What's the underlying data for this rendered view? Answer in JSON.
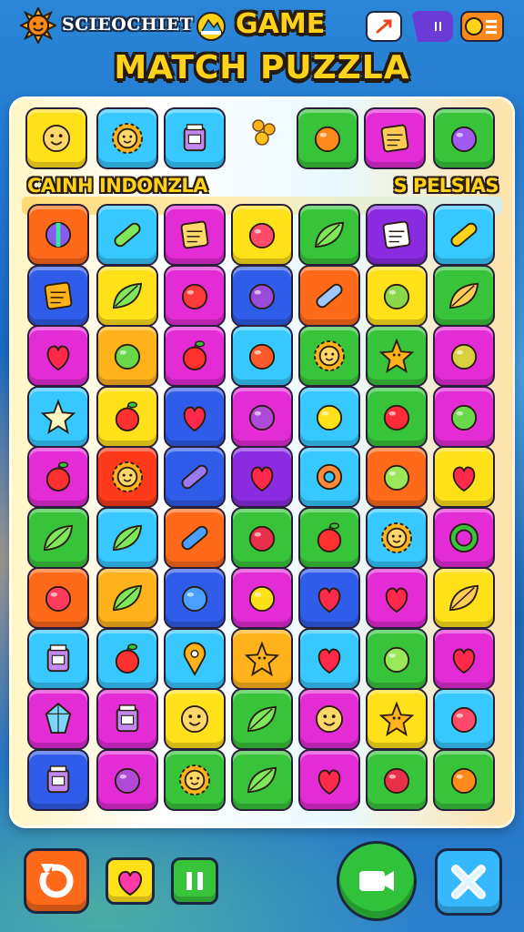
{
  "header": {
    "brand": "SCIEOCHIET",
    "game_word": "GAME",
    "title": "MATCH PUZZLA"
  },
  "board": {
    "label_left": "CAINH INDONZLA",
    "label_right": "S PELSIAS",
    "top_row": [
      {
        "color": "#ffe11a",
        "icon": "happy-face-icon"
      },
      {
        "color": "#36c8ff",
        "icon": "sun-face-icon"
      },
      {
        "color": "#36c8ff",
        "icon": "jar-icon"
      },
      {
        "color": "#37c43a",
        "icon": "orange-fruit-icon"
      },
      {
        "color": "#e32bd6",
        "icon": "toast-icon"
      },
      {
        "color": "#37c43a",
        "icon": "purple-face-icon"
      }
    ],
    "grid": [
      [
        {
          "color": "#ff6a1a",
          "icon": "shield-icon"
        },
        {
          "color": "#36c8ff",
          "icon": "cucumber-icon"
        },
        {
          "color": "#e32bd6",
          "icon": "map-icon"
        },
        {
          "color": "#ffe11a",
          "icon": "lollipop-icon"
        },
        {
          "color": "#37c43a",
          "icon": "leaf-star-icon"
        },
        {
          "color": "#8a2be2",
          "icon": "note-icon"
        },
        {
          "color": "#36c8ff",
          "icon": "banana-icon"
        }
      ],
      [
        {
          "color": "#2f5ce8",
          "icon": "cheese-icon"
        },
        {
          "color": "#ffe11a",
          "icon": "leaf-icon"
        },
        {
          "color": "#e32bd6",
          "icon": "tomato-face-icon"
        },
        {
          "color": "#2f5ce8",
          "icon": "grape-icon"
        },
        {
          "color": "#ff6a1a",
          "icon": "gadget-icon"
        },
        {
          "color": "#ffe11a",
          "icon": "kiwi-icon"
        },
        {
          "color": "#37c43a",
          "icon": "croissant-icon"
        }
      ],
      [
        {
          "color": "#e32bd6",
          "icon": "heart-icon"
        },
        {
          "color": "#ffb21a",
          "icon": "turtle-icon"
        },
        {
          "color": "#e32bd6",
          "icon": "apple-icon"
        },
        {
          "color": "#36c8ff",
          "icon": "pepper-icon"
        },
        {
          "color": "#37c43a",
          "icon": "sunflower-icon"
        },
        {
          "color": "#37c43a",
          "icon": "star-flower-icon"
        },
        {
          "color": "#e32bd6",
          "icon": "melon-icon"
        }
      ],
      [
        {
          "color": "#36c8ff",
          "icon": "star-icon"
        },
        {
          "color": "#ffe11a",
          "icon": "apple-icon"
        },
        {
          "color": "#2f5ce8",
          "icon": "heart-icon"
        },
        {
          "color": "#e32bd6",
          "icon": "ball-icon"
        },
        {
          "color": "#36c8ff",
          "icon": "lemon-icon"
        },
        {
          "color": "#37c43a",
          "icon": "cherry-icon"
        },
        {
          "color": "#e32bd6",
          "icon": "lime-icon"
        }
      ],
      [
        {
          "color": "#e32bd6",
          "icon": "apple-icon"
        },
        {
          "color": "#ff3a1a",
          "icon": "sun-face-icon"
        },
        {
          "color": "#2f5ce8",
          "icon": "eggplant-icon"
        },
        {
          "color": "#8a2be2",
          "icon": "heart-icon"
        },
        {
          "color": "#36c8ff",
          "icon": "donut-icon"
        },
        {
          "color": "#ff6a1a",
          "icon": "leaf-gem-icon"
        },
        {
          "color": "#ffe11a",
          "icon": "heart-icon"
        }
      ],
      [
        {
          "color": "#37c43a",
          "icon": "leaf-icon"
        },
        {
          "color": "#36c8ff",
          "icon": "leaf-icon"
        },
        {
          "color": "#ff6a1a",
          "icon": "can-icon"
        },
        {
          "color": "#37c43a",
          "icon": "berry-icon"
        },
        {
          "color": "#37c43a",
          "icon": "tomato-icon"
        },
        {
          "color": "#36c8ff",
          "icon": "sunflower-icon"
        },
        {
          "color": "#e32bd6",
          "icon": "ring-icon"
        }
      ],
      [
        {
          "color": "#ff6a1a",
          "icon": "strawberry-icon"
        },
        {
          "color": "#ffb21a",
          "icon": "leaf-icon"
        },
        {
          "color": "#2f5ce8",
          "icon": "blue-face-icon"
        },
        {
          "color": "#e32bd6",
          "icon": "lemon-icon"
        },
        {
          "color": "#2f5ce8",
          "icon": "heart-icon"
        },
        {
          "color": "#e32bd6",
          "icon": "heart-icon"
        },
        {
          "color": "#ffe11a",
          "icon": "croissant-icon"
        }
      ],
      [
        {
          "color": "#36c8ff",
          "icon": "jar-icon"
        },
        {
          "color": "#36c8ff",
          "icon": "apple-icon"
        },
        {
          "color": "#36c8ff",
          "icon": "pin-icon"
        },
        {
          "color": "#ffb21a",
          "icon": "star-flower-icon"
        },
        {
          "color": "#36c8ff",
          "icon": "heart-icon"
        },
        {
          "color": "#37c43a",
          "icon": "leaf-gem-icon"
        },
        {
          "color": "#e32bd6",
          "icon": "heart-icon"
        }
      ],
      [
        {
          "color": "#e32bd6",
          "icon": "gem-icon"
        },
        {
          "color": "#e32bd6",
          "icon": "jar-icon"
        },
        {
          "color": "#ffe11a",
          "icon": "happy-face-icon"
        },
        {
          "color": "#37c43a",
          "icon": "broccoli-icon"
        },
        {
          "color": "#e32bd6",
          "icon": "happy-face-icon"
        },
        {
          "color": "#ffe11a",
          "icon": "gingerbread-icon"
        },
        {
          "color": "#36c8ff",
          "icon": "lollipop-icon"
        }
      ],
      [
        {
          "color": "#2f5ce8",
          "icon": "jar-icon"
        },
        {
          "color": "#e32bd6",
          "icon": "ball-icon"
        },
        {
          "color": "#37c43a",
          "icon": "sunflower-icon"
        },
        {
          "color": "#37c43a",
          "icon": "leaf-icon"
        },
        {
          "color": "#e32bd6",
          "icon": "heart-icon"
        },
        {
          "color": "#37c43a",
          "icon": "berry-icon"
        },
        {
          "color": "#37c43a",
          "icon": "orange-fruit-icon"
        }
      ]
    ]
  },
  "colors": {
    "title_yellow": "#ffd21a",
    "outline_dark": "#241a10",
    "background_blue": "#1c6cc4"
  }
}
